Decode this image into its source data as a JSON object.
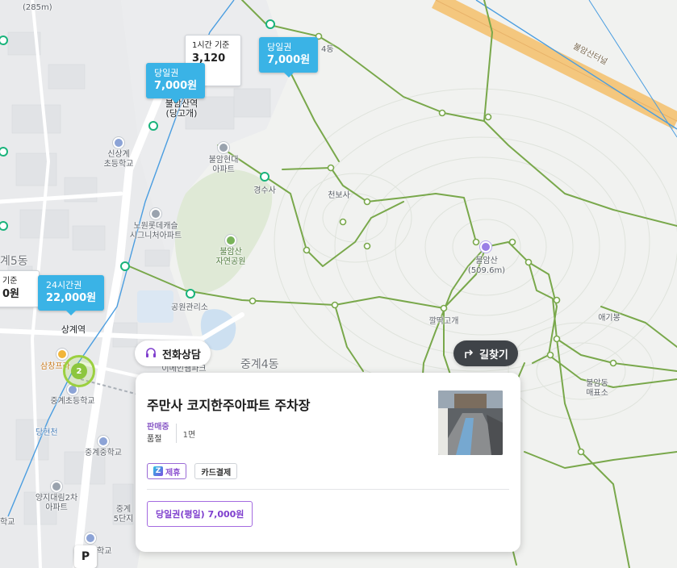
{
  "colors": {
    "accent_purple": "#8b4fd0",
    "price_tag_blue": "#3ab3e6",
    "trail_green": "#79a84b",
    "cluster_green": "#8cc63e",
    "summit_purple": "#9a7fe6"
  },
  "map_labels": {
    "elev_285": "(285m)",
    "gu_5dong": "계5동",
    "sinsanggye_school": "신상계\n초등학교",
    "bulam_hyundai": "불암현대\n아파트",
    "nowon_lotte": "노원롯데캐슬\n시그니처아파트",
    "bulamsan_park": "불암산\n자연공원",
    "gongwon_restroom": "공원관리소",
    "gyeongsusa": "경수사",
    "cheonbosa": "천보사",
    "bulamsan_summit": "불암산\n(509.6m)",
    "kkalttak_gogae": "깔딱고개",
    "aegibong": "애기봉",
    "bulamdong_ticket": "불암동\n매표소",
    "junggye4dong": "중계4동",
    "sanggye_station": "상계역",
    "samchang_plaza": "삼창프라",
    "junggye_elem": "중계초등학교",
    "danghyeoncheon": "당현천",
    "junggye_middle": "중계중학교",
    "yangji_daerim": "양지대림2차\n아파트",
    "junggye5_complex": "중계\n5단지",
    "hakgyo": "학교",
    "hakgyo2": "학교",
    "bulam_station_label": "불암산역\n(당고개)",
    "bulam_tunnel": "불암산터널",
    "dong4": "4동",
    "apartment_partial": "이메인웹파크"
  },
  "price_tags": [
    {
      "line1": "당일권",
      "line2": "7,000원"
    },
    {
      "line1": "당일권",
      "line2": "7,000원"
    },
    {
      "line1": "24시간권",
      "line2": "22,000원"
    }
  ],
  "white_tags": [
    {
      "line1": "1시간 기준",
      "line2": "3,120원"
    },
    {
      "line1": "기준",
      "line2": "0원"
    }
  ],
  "cluster_count": "2",
  "buttons": {
    "phone_consult": "전화상담",
    "directions": "길찾기",
    "parking": "P"
  },
  "card": {
    "title": "주만사 코지한주아파트 주차장",
    "status_selling": "판매중",
    "status_soldout": "품절",
    "spaces": "1면",
    "tags": [
      "제휴",
      "카드결제"
    ],
    "partner_logo": "Z",
    "ticket": "당일권(평일) 7,000원"
  }
}
